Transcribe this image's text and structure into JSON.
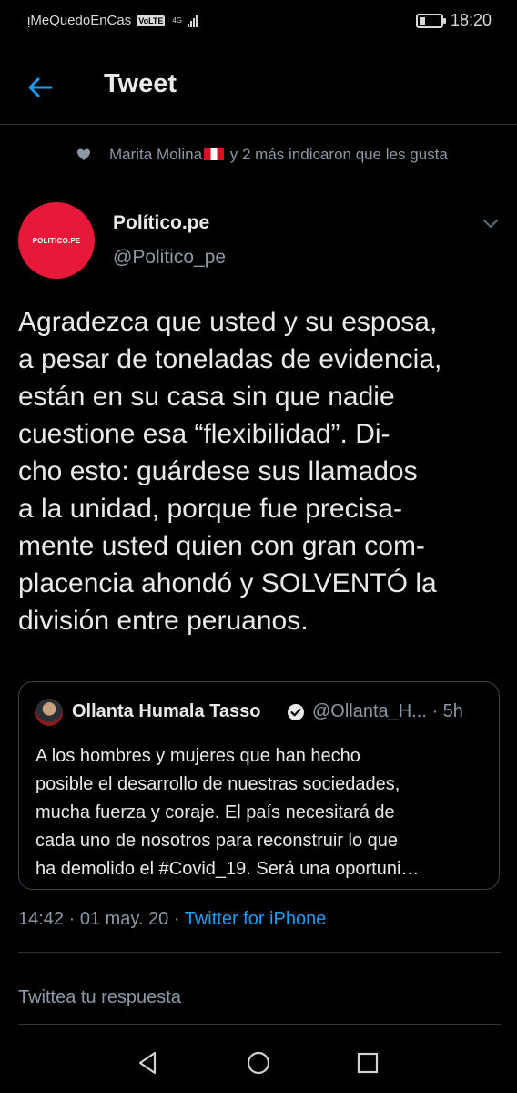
{
  "status_bar": {
    "carrier": "ᴉMeQuedoEnCas",
    "volte": "VoLTE",
    "network": "4G",
    "time": "18:20"
  },
  "header": {
    "title": "Tweet"
  },
  "social_context": {
    "name": "Marita Molina",
    "text": " y 2 más indicaron que les gusta"
  },
  "author": {
    "avatar_text": "POLITICO.PE",
    "name": "Político.pe",
    "handle": "@Politico_pe"
  },
  "tweet": {
    "lines": [
      "Agradezca que usted y su esposa,",
      "a pesar de toneladas de evidencia,",
      "están en su casa sin que nadie",
      "cuestione esa “flexibilidad”.  Di-",
      "cho esto: guárdese sus llamados",
      "a la unidad, porque fue precisa-",
      "mente usted quien con gran com-",
      "placencia ahondó y SOLVENTÓ la",
      "división entre peruanos."
    ]
  },
  "quote": {
    "name": "Ollanta Humala Tasso",
    "handle": "@Ollanta_H... · 5h",
    "lines": [
      "A los hombres y mujeres que han hecho",
      "posible el desarrollo de nuestras sociedades,",
      "mucha fuerza y coraje. El país necesitará de",
      "cada uno de nosotros para reconstruir lo que",
      "ha demolido el #Covid_19. Será una oportuni…"
    ]
  },
  "meta": {
    "timestamp": "14:42 · 01 may. 20 · ",
    "source": "Twitter for iPhone"
  },
  "reply": {
    "placeholder": "Twittea tu respuesta"
  },
  "colors": {
    "background": "#000000",
    "accent": "#1d9bf0",
    "muted": "#8b98a5",
    "avatar": "#e8183a"
  },
  "icons": [
    "back-arrow-icon",
    "heart-icon",
    "chevron-down-icon",
    "verified-icon",
    "nav-back-icon",
    "nav-home-icon",
    "nav-recents-icon"
  ]
}
